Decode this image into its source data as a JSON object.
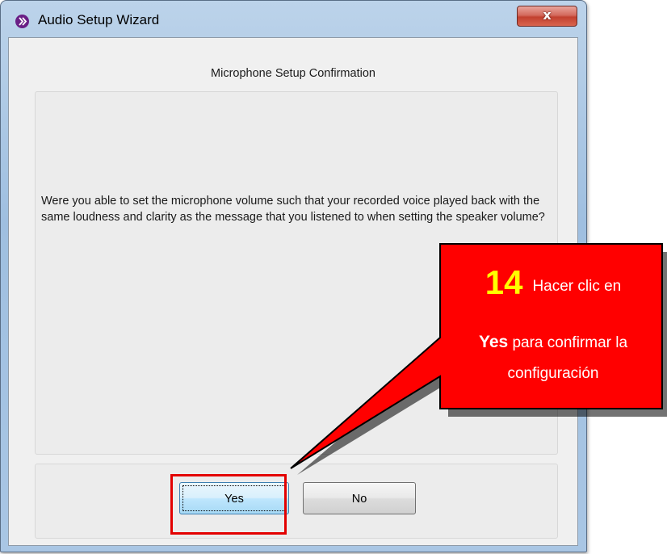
{
  "window": {
    "title": "Audio Setup Wizard",
    "close_glyph": "x",
    "accent": "#6a1f86"
  },
  "header": {
    "title": "Microphone Setup Confirmation"
  },
  "content": {
    "question": "Were you able to set the microphone volume such that your recorded voice played back with the same loudness and clarity as the message that you listened to when setting the speaker volume?"
  },
  "buttons": {
    "yes_label": "Yes",
    "no_label": "No"
  },
  "annotation": {
    "step_number": "14",
    "line1_text": "Hacer clic en",
    "line2_bold": "Yes",
    "line2_text": "para  confirmar la",
    "line3_text": "configuración",
    "box_color": "#ff0000",
    "number_color": "#ffff00"
  }
}
